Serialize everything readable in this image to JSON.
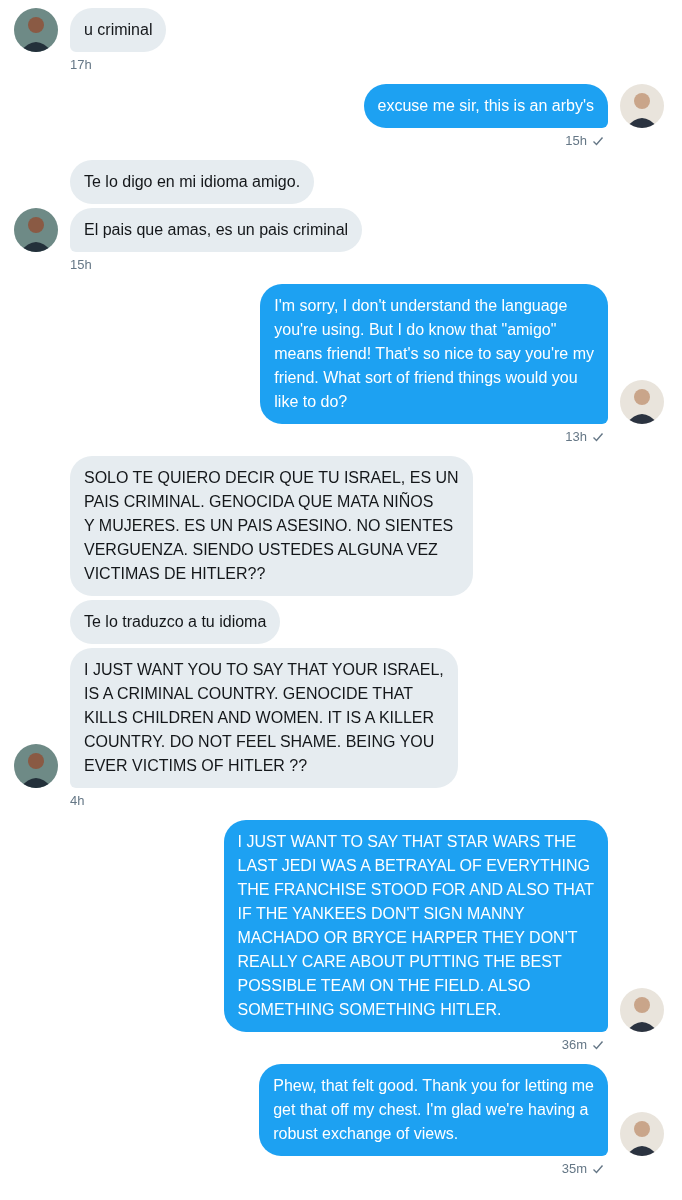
{
  "groups": [
    {
      "kind": "incoming",
      "messages": [
        "u criminal"
      ],
      "time": "17h"
    },
    {
      "kind": "outgoing",
      "messages": [
        "excuse me sir, this is an arby's"
      ],
      "time": "15h",
      "read": true
    },
    {
      "kind": "incoming",
      "messages": [
        "Te lo digo en mi idioma amigo.",
        "El pais que amas, es un pais criminal"
      ],
      "time": "15h"
    },
    {
      "kind": "outgoing",
      "messages": [
        "I'm sorry, I don't understand the language\nyou're using. But I do know that \"amigo\"\nmeans friend! That's so nice to say you're my\nfriend. What sort of friend things would you\nlike to do?"
      ],
      "time": "13h",
      "read": true
    },
    {
      "kind": "incoming",
      "messages": [
        "SOLO TE QUIERO DECIR QUE TU ISRAEL, ES UN\nPAIS CRIMINAL. GENOCIDA QUE MATA NIÑOS\nY MUJERES. ES UN PAIS ASESINO. NO SIENTES\nVERGUENZA. SIENDO USTEDES ALGUNA VEZ\nVICTIMAS DE HITLER??",
        "Te lo traduzco a tu idioma",
        "I JUST WANT YOU TO SAY THAT YOUR ISRAEL,\nIS A CRIMINAL COUNTRY. GENOCIDE THAT\nKILLS CHILDREN AND WOMEN. IT IS A KILLER\nCOUNTRY. DO NOT FEEL SHAME. BEING YOU\nEVER VICTIMS OF HITLER ??"
      ],
      "time": "4h"
    },
    {
      "kind": "outgoing",
      "messages": [
        "I JUST WANT TO SAY THAT STAR WARS THE\nLAST JEDI WAS A BETRAYAL OF EVERYTHING\nTHE FRANCHISE STOOD FOR AND ALSO THAT\nIF THE YANKEES DON'T SIGN MANNY\nMACHADO OR BRYCE HARPER THEY DON'T\nREALLY CARE ABOUT PUTTING THE BEST\nPOSSIBLE TEAM ON THE FIELD. ALSO\nSOMETHING SOMETHING HITLER."
      ],
      "time": "36m",
      "read": true
    },
    {
      "kind": "outgoing",
      "messages": [
        "Phew, that felt good. Thank you for letting me\nget that off my chest. I'm glad we're having a\nrobust exchange of views."
      ],
      "time": "35m",
      "read": true
    }
  ]
}
